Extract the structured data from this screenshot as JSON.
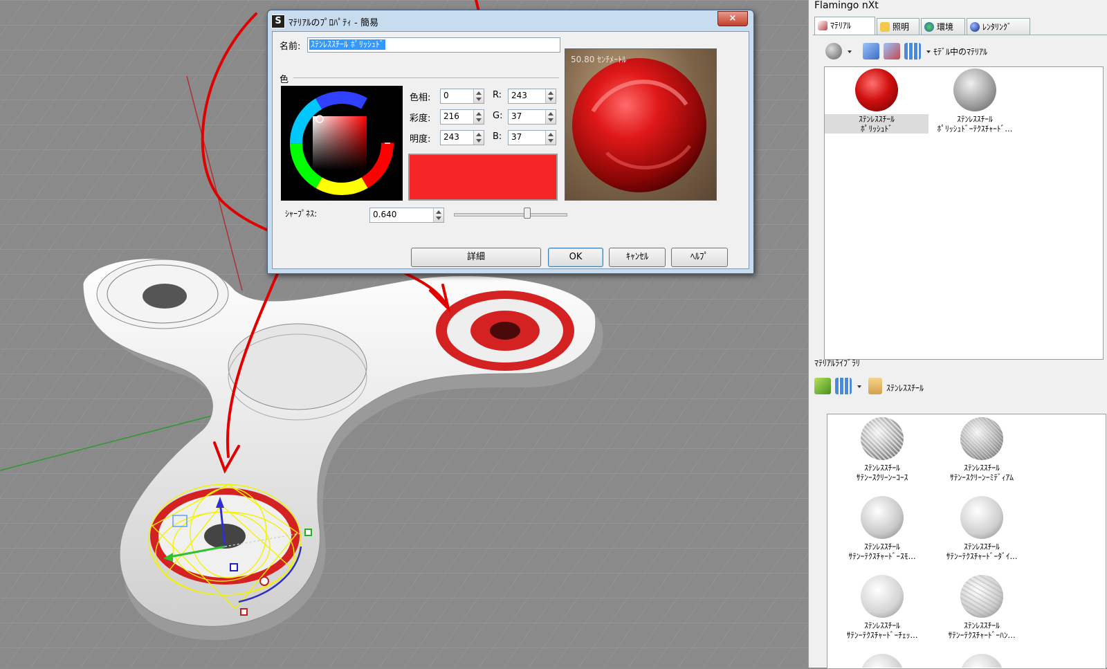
{
  "dialog": {
    "title": "ﾏﾃﾘｱﾙのﾌﾟﾛﾊﾟﾃｨ - 簡易",
    "close_icon": "×",
    "name_label": "名前:",
    "name_value": "ｽﾃﾝﾚｽｽﾁｰﾙ ﾎﾟﾘｯｼｭﾄﾞ",
    "color_section": "色",
    "hue_label": "色相:",
    "hue": "0",
    "sat_label": "彩度:",
    "sat": "216",
    "val_label": "明度:",
    "val": "243",
    "r_label": "R:",
    "r": "243",
    "g_label": "G:",
    "g": "37",
    "b_label": "B:",
    "b": "37",
    "swatch_color": "#f32525",
    "preview_caption": "50.80 ｾﾝﾁﾒｰﾄﾙ",
    "sharpness_label": "ｼｬｰﾌﾟﾈｽ:",
    "sharpness": "0.640",
    "sharpness_level": 0.64,
    "btn_detail": "詳細",
    "btn_ok": "OK",
    "btn_cancel": "ｷｬﾝｾﾙ",
    "btn_help": "ﾍﾙﾌﾟ"
  },
  "panel": {
    "title": "Flamingo nXt",
    "tabs": [
      {
        "label": "ﾏﾃﾘｱﾙ",
        "icon": "material-icon"
      },
      {
        "label": "照明",
        "icon": "light-icon"
      },
      {
        "label": "環境",
        "icon": "environment-icon"
      },
      {
        "label": "ﾚﾝﾀﾘﾝｸﾞ",
        "icon": "rendering-icon"
      }
    ],
    "model_dropdown": "ﾓﾃﾞﾙ中のﾏﾃﾘｱﾙ",
    "model_materials": [
      {
        "line1": "ｽﾃﾝﾚｽｽﾁｰﾙ",
        "line2": "ﾎﾟﾘｯｼｭﾄﾞ"
      },
      {
        "line1": "ｽﾃﾝﾚｽｽﾁｰﾙ",
        "line2": "ﾎﾟﾘｯｼｭﾄﾞｰﾃｸｽﾁｬｰﾄﾞ..."
      }
    ],
    "library_title": "ﾏﾃﾘｱﾙﾗｲﾌﾞﾗﾘ",
    "library_folder": "ｽﾃﾝﾚｽｽﾁｰﾙ",
    "library_materials": [
      {
        "line1": "ｽﾃﾝﾚｽｽﾁｰﾙ",
        "line2": "ｻﾃﾝｰｽｸﾘｰﾝｰｺｰｽ"
      },
      {
        "line1": "ｽﾃﾝﾚｽｽﾁｰﾙ",
        "line2": "ｻﾃﾝｰｽｸﾘｰﾝｰﾐﾃﾞｨｱﾑ"
      },
      {
        "line1": "ｽﾃﾝﾚｽｽﾁｰﾙ",
        "line2": "ｻﾃﾝｰﾃｸｽﾁｬｰﾄﾞｰｽﾓ..."
      },
      {
        "line1": "ｽﾃﾝﾚｽｽﾁｰﾙ",
        "line2": "ｻﾃﾝｰﾃｸｽﾁｬｰﾄﾞｰﾀﾞｲ..."
      },
      {
        "line1": "ｽﾃﾝﾚｽｽﾁｰﾙ",
        "line2": "ｻﾃﾝｰﾃｸｽﾁｬｰﾄﾞｰﾁｪｯ..."
      },
      {
        "line1": "ｽﾃﾝﾚｽｽﾁｰﾙ",
        "line2": "ｻﾃﾝｰﾃｸｽﾁｬｰﾄﾞｰﾊﾝ..."
      }
    ]
  }
}
